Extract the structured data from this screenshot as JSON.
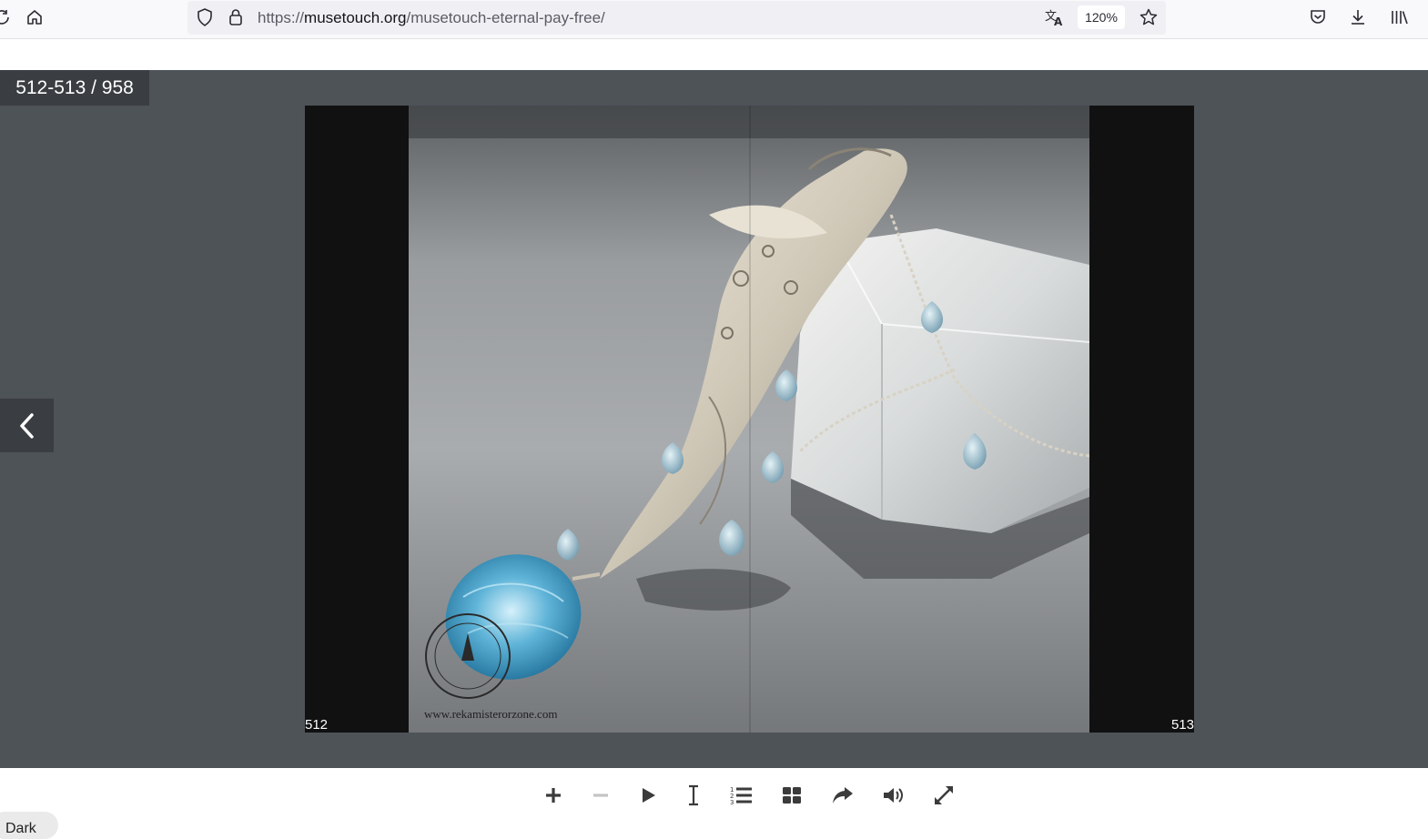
{
  "browser": {
    "url_prefix": "https://",
    "url_host": "musetouch.org",
    "url_path": "/musetouch-eternal-pay-free/",
    "zoom": "120%"
  },
  "viewer": {
    "page_counter": "512-513 / 958",
    "left_page_number": "512",
    "right_page_number": "513",
    "watermark": "www.rekamisterorzone.com",
    "photo_subject": "silver filigree pendant with blue topaz stones on a quartz crystal"
  },
  "toolbar": {
    "buttons": [
      "zoom-in",
      "zoom-out",
      "play",
      "text",
      "table-of-contents",
      "thumbnails",
      "share",
      "sound",
      "fullscreen"
    ]
  },
  "theme_toggle": {
    "label": "Dark"
  }
}
